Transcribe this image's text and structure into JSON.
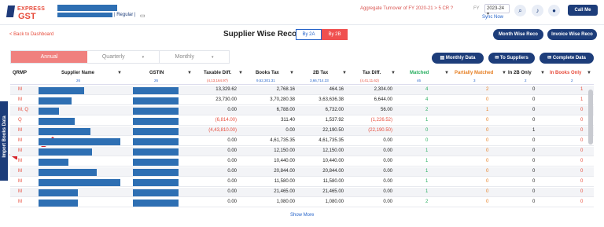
{
  "brand": {
    "line1": "EXPRESS",
    "line2": "GST"
  },
  "header": {
    "regular": "| Regular |",
    "gst_icon": "GSTIN",
    "turnover": "Aggregate Turnover of FY 2020-21 > 5 CR ?",
    "fy_label": "FY",
    "fy_value": "2023-24 ▾",
    "sync": "Sync Now",
    "callme": "Call Me"
  },
  "nav": {
    "back": "< Back to Dashboard",
    "title": "Supplier Wise Reco.",
    "toggle_a": "By 2A",
    "toggle_b": "By 2B",
    "month_wise": "Month Wise Reco",
    "invoice_wise": "Invoice Wise Reco"
  },
  "tabs": {
    "annual": "Annual",
    "quarterly": "Quarterly",
    "monthly": "Monthly"
  },
  "actions": {
    "monthly_data": "Monthly Data",
    "to_suppliers": "To Suppliers",
    "complete_data": "Complete Data"
  },
  "side_tab": "Import Books Data",
  "columns": {
    "qrmp": "QRMP",
    "supplier": "Supplier Name",
    "gstin": "GSTIN",
    "taxable_diff": "Taxable Diff.",
    "books_tax": "Books Tax",
    "tax_2b": "2B Tax",
    "tax_diff": "Tax Diff.",
    "matched": "Matched",
    "partially": "Partially Matched",
    "in2b": "In 2B Only",
    "inbooks": "In Books Only"
  },
  "counts": {
    "supplier": "26",
    "gstin": "26",
    "taxable_diff": "(4,13,164.97)",
    "books_tax": "9,52,301.31",
    "tax_2b": "3,66,714.33",
    "tax_diff": "(4,41,11.62)",
    "matched": "46",
    "partially": "3",
    "in2b": "2",
    "inbooks": "2"
  },
  "rows": [
    {
      "qrmp": "M",
      "taxable": "13,329.62",
      "books": "2,768.16",
      "b2b": "464.16",
      "diff": "2,304.00",
      "matched": "4",
      "partial": "2",
      "in2b": "0",
      "inbooks": "1"
    },
    {
      "qrmp": "M",
      "taxable": "23,730.00",
      "books": "3,70,280.38",
      "b2b": "3,63,636.38",
      "diff": "6,644.00",
      "matched": "4",
      "partial": "0",
      "in2b": "0",
      "inbooks": "1"
    },
    {
      "qrmp": "M, Q",
      "taxable": "0.00",
      "books": "6,788.00",
      "b2b": "6,732.00",
      "diff": "56.00",
      "matched": "2",
      "partial": "1",
      "in2b": "0",
      "inbooks": "0"
    },
    {
      "qrmp": "Q",
      "taxable": "(6,814.00)",
      "books": "311.40",
      "b2b": "1,537.92",
      "diff": "(1,226.52)",
      "matched": "1",
      "partial": "0",
      "in2b": "0",
      "inbooks": "0"
    },
    {
      "qrmp": "M",
      "taxable": "(4,43,810.00)",
      "books": "0.00",
      "b2b": "22,190.50",
      "diff": "(22,190.50)",
      "matched": "0",
      "partial": "0",
      "in2b": "1",
      "inbooks": "0"
    },
    {
      "qrmp": "M",
      "taxable": "0.00",
      "books": "4,61,735.35",
      "b2b": "4,61,735.35",
      "diff": "0.00",
      "matched": "0",
      "partial": "0",
      "in2b": "0",
      "inbooks": "0"
    },
    {
      "qrmp": "M",
      "taxable": "0.00",
      "books": "12,150.00",
      "b2b": "12,150.00",
      "diff": "0.00",
      "matched": "1",
      "partial": "0",
      "in2b": "0",
      "inbooks": "0"
    },
    {
      "qrmp": "M",
      "taxable": "0.00",
      "books": "10,440.00",
      "b2b": "10,440.00",
      "diff": "0.00",
      "matched": "1",
      "partial": "0",
      "in2b": "0",
      "inbooks": "0"
    },
    {
      "qrmp": "M",
      "taxable": "0.00",
      "books": "20,844.00",
      "b2b": "20,844.00",
      "diff": "0.00",
      "matched": "1",
      "partial": "0",
      "in2b": "0",
      "inbooks": "0"
    },
    {
      "qrmp": "M",
      "taxable": "0.00",
      "books": "11,580.00",
      "b2b": "11,580.00",
      "diff": "0.00",
      "matched": "1",
      "partial": "0",
      "in2b": "0",
      "inbooks": "0"
    },
    {
      "qrmp": "M",
      "taxable": "0.00",
      "books": "21,465.00",
      "b2b": "21,465.00",
      "diff": "0.00",
      "matched": "1",
      "partial": "0",
      "in2b": "0",
      "inbooks": "0"
    },
    {
      "qrmp": "M",
      "taxable": "0.00",
      "books": "1,080.00",
      "b2b": "1,080.00",
      "diff": "0.00",
      "matched": "2",
      "partial": "0",
      "in2b": "0",
      "inbooks": "0"
    }
  ],
  "show_more": "Show More",
  "colors": {
    "navy": "#1d3d7a",
    "accent": "#f0504f",
    "blue": "#2e6fb3"
  }
}
